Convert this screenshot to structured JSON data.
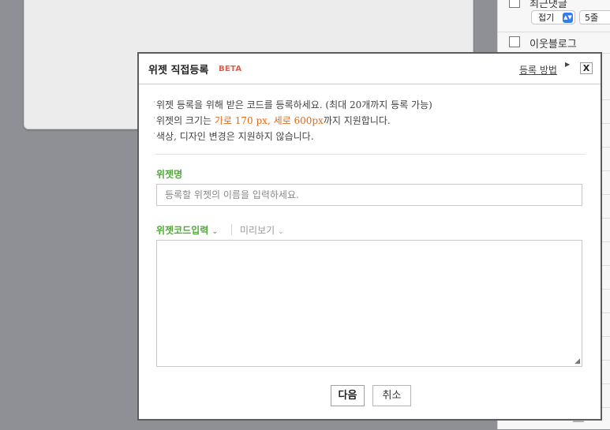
{
  "background": {
    "right_panel": {
      "top_item_label": "최근댓글",
      "collapse_select": "접기",
      "rows_select": "5줄",
      "neighbor_blog_label": "이웃블로그"
    }
  },
  "modal": {
    "title": "위젯 직접등록",
    "badge": "BETA",
    "howto_link": "등록 방법",
    "close_label": "X",
    "notes": [
      {
        "pre": "위젯 등록을 위해 받은 코드를 등록하세요. (최대 20개까지 등록 가능)",
        "highlight": "",
        "post": ""
      },
      {
        "pre": "위젯의 크기는 ",
        "highlight": "가로 170 px, 세로 600px",
        "post": "까지 지원합니다."
      },
      {
        "pre": "색상, 디자인 변경은 지원하지 않습니다.",
        "highlight": "",
        "post": ""
      }
    ],
    "name_label": "위젯명",
    "name_placeholder": "등록할 위젯의 이름을 입력하세요.",
    "code_tab": "위젯코드입력",
    "preview_tab": "미리보기",
    "next_button": "다음",
    "cancel_button": "취소"
  },
  "colors": {
    "accent_green": "#52a93b",
    "highlight_orange": "#e06a1c",
    "beta_red": "#e05b4a"
  }
}
